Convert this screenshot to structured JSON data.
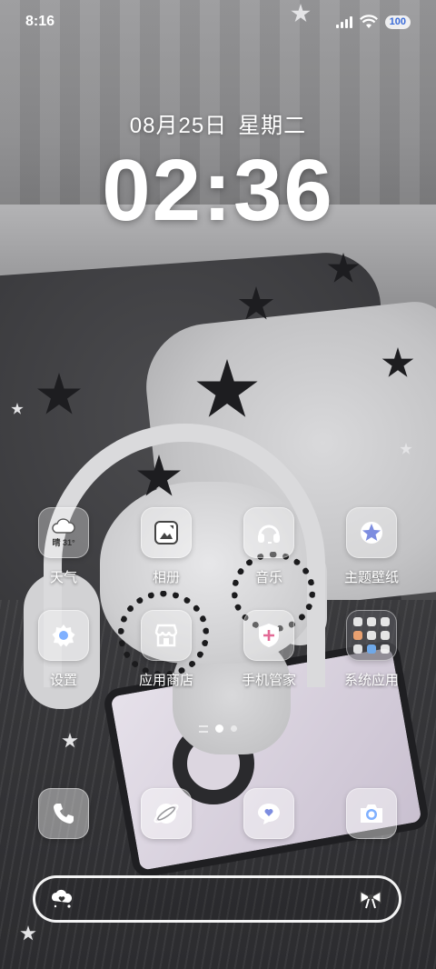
{
  "status_bar": {
    "time": "8:16",
    "battery": "100",
    "icons": [
      "signal-icon",
      "wifi-icon",
      "battery-icon"
    ]
  },
  "lockscreen_clock": {
    "date": "08月25日",
    "weekday": "星期二",
    "time": "02:36"
  },
  "apps_row1": [
    {
      "label": "天气",
      "icon": "weather-icon",
      "badge": "晴 31°"
    },
    {
      "label": "相册",
      "icon": "gallery-icon"
    },
    {
      "label": "音乐",
      "icon": "headphones-icon"
    },
    {
      "label": "主题壁纸",
      "icon": "themes-icon"
    }
  ],
  "apps_row2": [
    {
      "label": "设置",
      "icon": "gear-icon"
    },
    {
      "label": "应用商店",
      "icon": "store-icon"
    },
    {
      "label": "手机管家",
      "icon": "shield-plus-icon"
    },
    {
      "label": "系统应用",
      "icon": "folder-icon"
    }
  ],
  "page_indicator": {
    "pages": 2,
    "current": 1
  },
  "dock": [
    {
      "icon": "phone-icon"
    },
    {
      "icon": "browser-icon"
    },
    {
      "icon": "message-icon"
    },
    {
      "icon": "camera-icon"
    }
  ],
  "search_bar": {
    "left_icon": "heart-cloud-icon",
    "right_icon": "bow-icon"
  },
  "colors": {
    "accent": "#7fb0ff",
    "battery_text": "#3a6bd8"
  }
}
